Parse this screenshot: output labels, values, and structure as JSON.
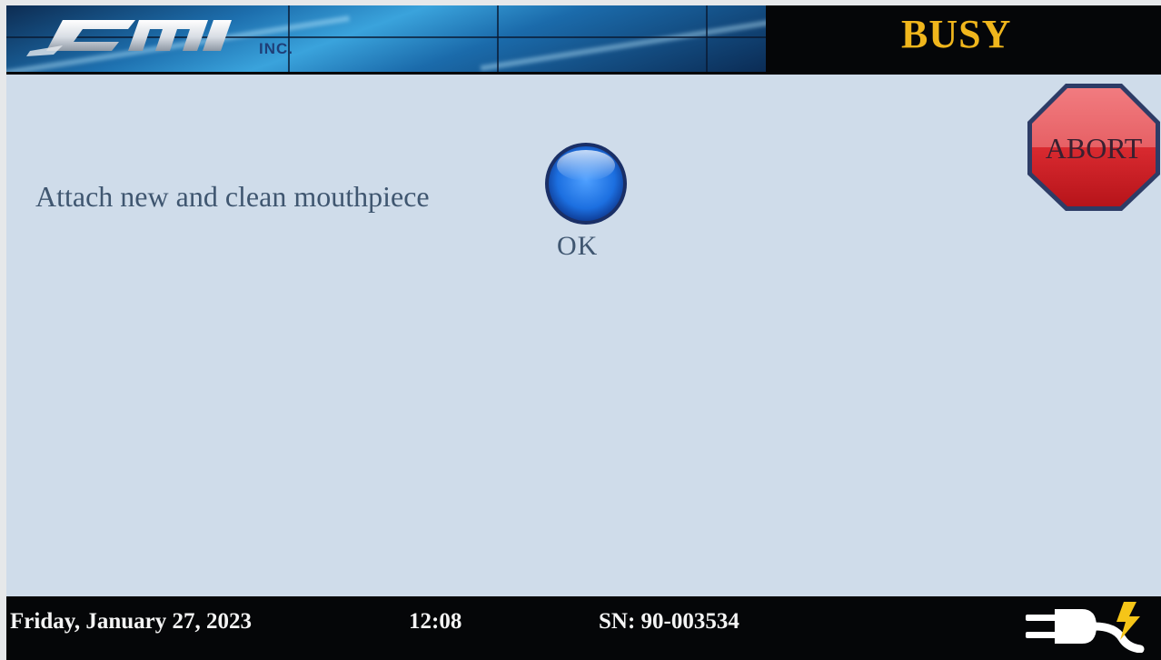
{
  "header": {
    "logo_text": "CMI",
    "logo_suffix": "INC.",
    "status": "BUSY"
  },
  "main": {
    "prompt": "Attach new and clean mouthpiece",
    "ok_label": "OK",
    "abort_label": "ABORT"
  },
  "footer": {
    "date": "Friday, January 27, 2023",
    "time": "12:08",
    "serial": "SN: 90-003534",
    "power_icon": "power-plug-icon"
  },
  "colors": {
    "status": "#f0b61c",
    "ok_button": "#1e6fd8",
    "abort_button": "#d42027",
    "background": "#cfdcea"
  }
}
